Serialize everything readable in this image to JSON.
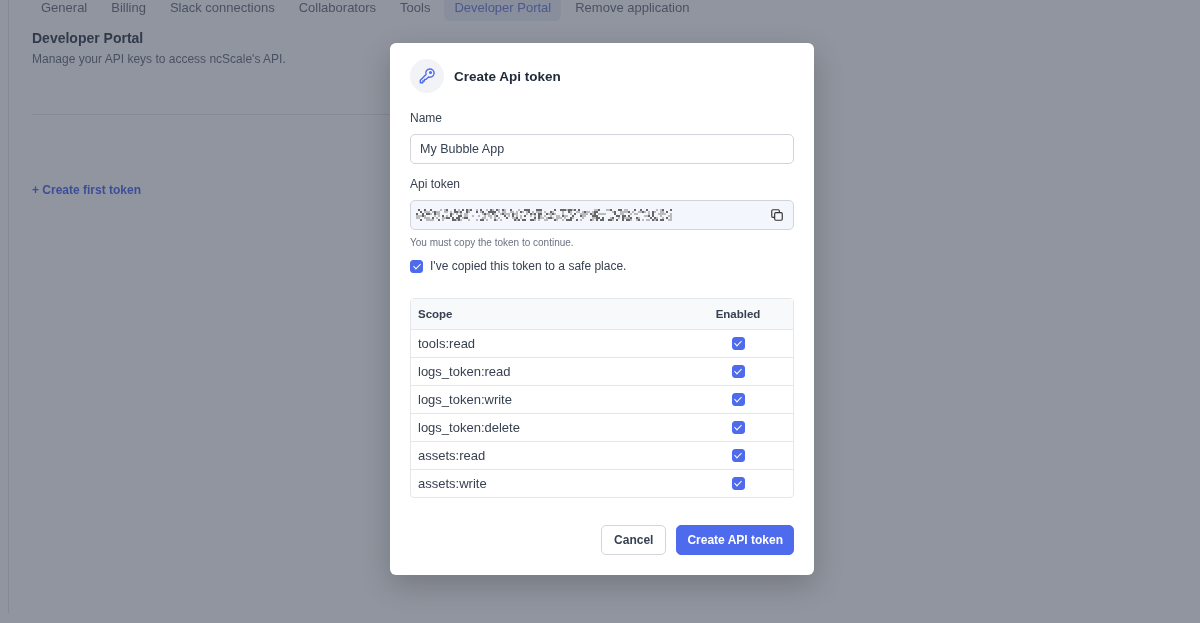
{
  "tabs": [
    {
      "label": "General",
      "selected": false
    },
    {
      "label": "Billing",
      "selected": false
    },
    {
      "label": "Slack connections",
      "selected": false
    },
    {
      "label": "Collaborators",
      "selected": false
    },
    {
      "label": "Tools",
      "selected": false
    },
    {
      "label": "Developer Portal",
      "selected": true
    },
    {
      "label": "Remove application",
      "selected": false
    }
  ],
  "page": {
    "title": "Developer Portal",
    "subtitle": "Manage your API keys to access ncScale's API.",
    "create_link": "+ Create first token"
  },
  "modal": {
    "title": "Create Api token",
    "name_label": "Name",
    "name_value": "My Bubble App",
    "token_label": "Api token",
    "token_hint": "You must copy the token to continue.",
    "copied": {
      "label": "I've copied this token to a safe place.",
      "checked": true
    },
    "table": {
      "columns": [
        "Scope",
        "Enabled"
      ],
      "rows": [
        {
          "scope": "tools:read",
          "enabled": true
        },
        {
          "scope": "logs_token:read",
          "enabled": true
        },
        {
          "scope": "logs_token:write",
          "enabled": true
        },
        {
          "scope": "logs_token:delete",
          "enabled": true
        },
        {
          "scope": "assets:read",
          "enabled": true
        },
        {
          "scope": "assets:write",
          "enabled": true
        }
      ]
    },
    "buttons": [
      {
        "label": "Cancel",
        "kind": "secondary"
      },
      {
        "label": "Create API token",
        "kind": "primary"
      }
    ]
  }
}
